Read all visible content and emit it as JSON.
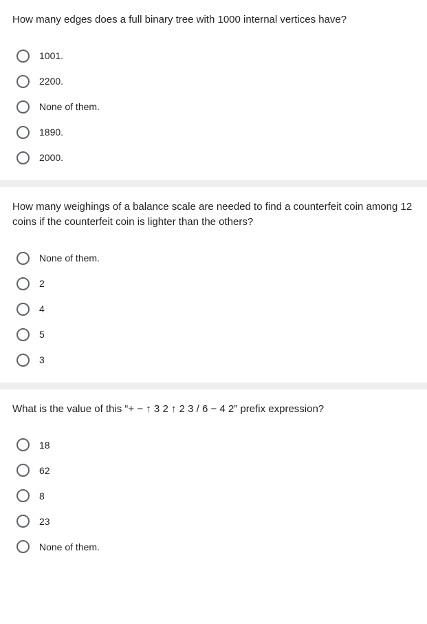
{
  "questions": [
    {
      "prompt": "How many edges does a full binary tree with 1000 internal vertices have?",
      "options": [
        "1001.",
        "2200.",
        "None of them.",
        "1890.",
        "2000."
      ]
    },
    {
      "prompt": "How many weighings of a balance scale are needed to find a counterfeit coin among 12 coins if the counterfeit coin is lighter than the others?",
      "options": [
        "None of them.",
        "2",
        "4",
        "5",
        "3"
      ]
    },
    {
      "prompt": "What is the value of this “+ − ↑ 3 2 ↑ 2 3 / 6 − 4 2” prefix expression?",
      "options": [
        "18",
        "62",
        "8",
        "23",
        "None of them."
      ]
    }
  ]
}
